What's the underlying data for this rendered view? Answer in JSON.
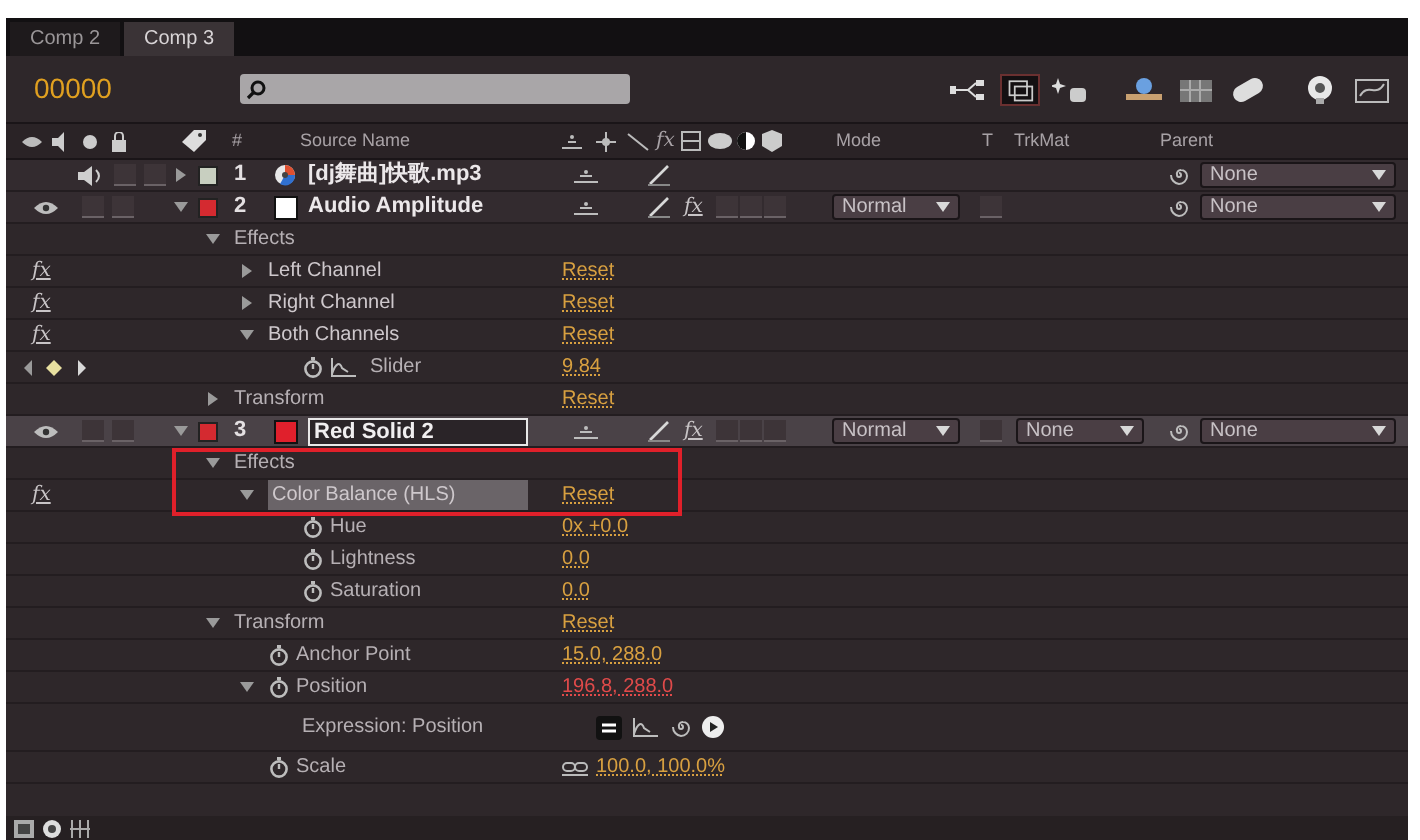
{
  "tabs": [
    {
      "label": "Comp 2",
      "selected": false
    },
    {
      "label": "Comp 3",
      "selected": true
    }
  ],
  "timecode": "00000",
  "columns": {
    "number": "#",
    "source_name": "Source Name",
    "switch_fx": "fx",
    "mode": "Mode",
    "t": "T",
    "trkmat": "TrkMat",
    "parent": "Parent"
  },
  "layers": [
    {
      "number": "1",
      "name": "[dj舞曲]快歌.mp3",
      "color": "#c8cfc0",
      "kind": "audio",
      "selected": false,
      "expanded": false,
      "parent": "None"
    },
    {
      "number": "2",
      "name": "Audio Amplitude",
      "color": "#d42a30",
      "source": {
        "color": "#ffffff"
      },
      "kind": "solid",
      "selected": false,
      "expanded": true,
      "fx": "fx",
      "mode": "Normal",
      "parent": "None",
      "properties": [
        {
          "label": "Effects",
          "kind": "group",
          "expanded": true,
          "children": [
            {
              "label": "Left Channel",
              "kind": "effect",
              "switch": "fx",
              "enabled": true,
              "expanded": false,
              "selected": false,
              "value": "Reset"
            },
            {
              "label": "Right Channel",
              "kind": "effect",
              "switch": "fx",
              "enabled": true,
              "expanded": false,
              "selected": false,
              "value": "Reset"
            },
            {
              "label": "Both Channels",
              "kind": "effect",
              "switch": "fx",
              "enabled": true,
              "expanded": true,
              "selected": false,
              "value": "Reset",
              "children": [
                {
                  "label": "Slider",
                  "kind": "property",
                  "value": "9.84",
                  "graph": true,
                  "keyframe_nav": true
                }
              ]
            }
          ]
        },
        {
          "label": "Transform",
          "kind": "group",
          "expanded": false,
          "value": "Reset"
        }
      ]
    },
    {
      "number": "3",
      "name": "Red Solid 2",
      "color": "#d42a30",
      "source": {
        "color": "#e0202c"
      },
      "kind": "solid",
      "selected": true,
      "expanded": true,
      "fx": "fx",
      "mode": "Normal",
      "trkmat": "None",
      "parent": "None",
      "properties": [
        {
          "label": "Effects",
          "kind": "group",
          "expanded": true,
          "framed": true,
          "children": [
            {
              "label": "Color Balance (HLS)",
              "kind": "effect",
              "switch": "fx",
              "enabled": true,
              "expanded": true,
              "selected": true,
              "framed": true,
              "value": "Reset",
              "children": [
                {
                  "label": "Hue",
                  "kind": "property",
                  "value": "0x +0.0"
                },
                {
                  "label": "Lightness",
                  "kind": "property",
                  "value": "0.0"
                },
                {
                  "label": "Saturation",
                  "kind": "property",
                  "value": "0.0"
                }
              ]
            }
          ]
        },
        {
          "label": "Transform",
          "kind": "group",
          "expanded": true,
          "value": "Reset",
          "children": [
            {
              "label": "Anchor Point",
              "kind": "property",
              "value": "15.0, 288.0"
            },
            {
              "label": "Position",
              "kind": "property",
              "expanded": true,
              "expression": true,
              "value": "196.8, 288.0",
              "children": [
                {
                  "label": "Expression: Position",
                  "kind": "expression"
                }
              ]
            },
            {
              "label": "Scale",
              "kind": "property",
              "linked": true,
              "value": "100.0, 100.0%"
            }
          ]
        }
      ]
    }
  ]
}
